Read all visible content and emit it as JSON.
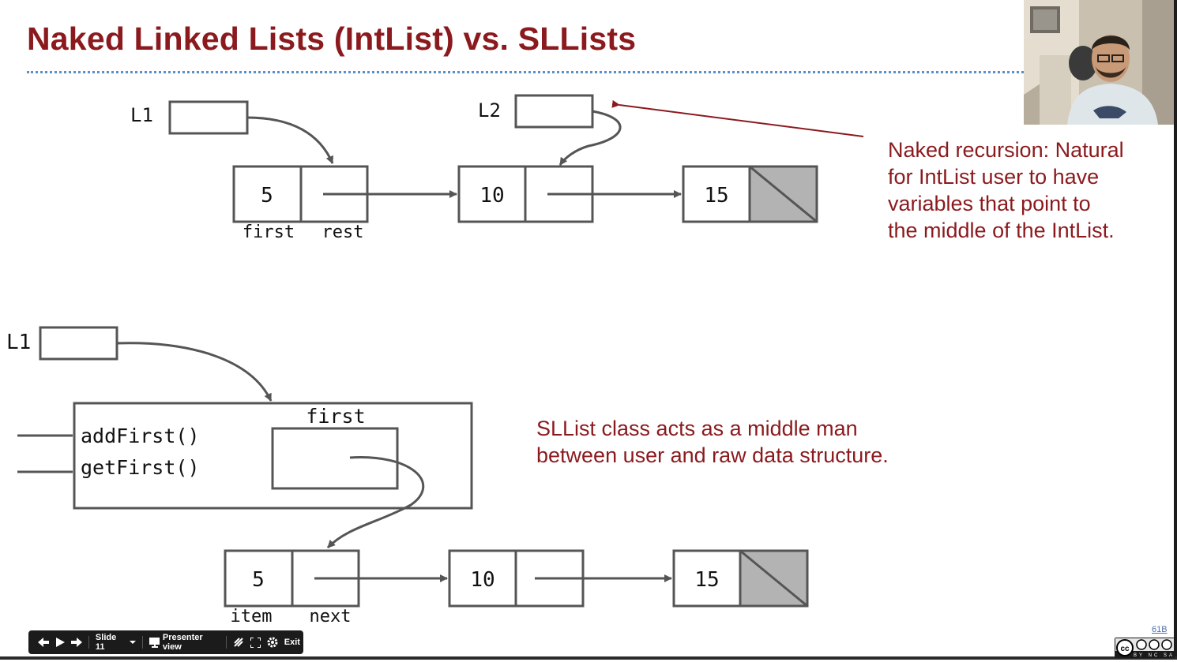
{
  "slide": {
    "title": "Naked Linked Lists (IntList) vs. SLLists",
    "number_label": "61B"
  },
  "top_diagram": {
    "var_l1": "L1",
    "var_l2": "L2",
    "nodes": [
      {
        "value": "5",
        "null_rest": false
      },
      {
        "value": "10",
        "null_rest": false
      },
      {
        "value": "15",
        "null_rest": true
      }
    ],
    "field_labels": [
      "first",
      "rest"
    ]
  },
  "top_note": {
    "lines": [
      "Naked recursion: Natural",
      "for IntList user to have",
      "variables that point to",
      "the middle of the IntList."
    ]
  },
  "bottom_diagram": {
    "var_l1": "L1",
    "methods": [
      "addFirst()",
      "getFirst()"
    ],
    "field_first": "first",
    "nodes": [
      {
        "value": "5",
        "null_rest": false
      },
      {
        "value": "10",
        "null_rest": false
      },
      {
        "value": "15",
        "null_rest": true
      }
    ],
    "field_labels": [
      "item",
      "next"
    ]
  },
  "bottom_note": {
    "lines": [
      "SLList class acts as a middle man",
      "between user and raw data structure."
    ]
  },
  "controls": {
    "slide_label": "Slide 11",
    "presenter_label": "Presenter view",
    "exit_label": "Exit"
  },
  "license_badge": {
    "text": "BY NC SA"
  },
  "colors": {
    "title": "#8b1a1e",
    "note": "#8b1a1e",
    "rule": "#5b8fc7",
    "arrow_note": "#8b1a1e",
    "box_stroke": "#555555",
    "null_fill": "#b3b3b3"
  }
}
